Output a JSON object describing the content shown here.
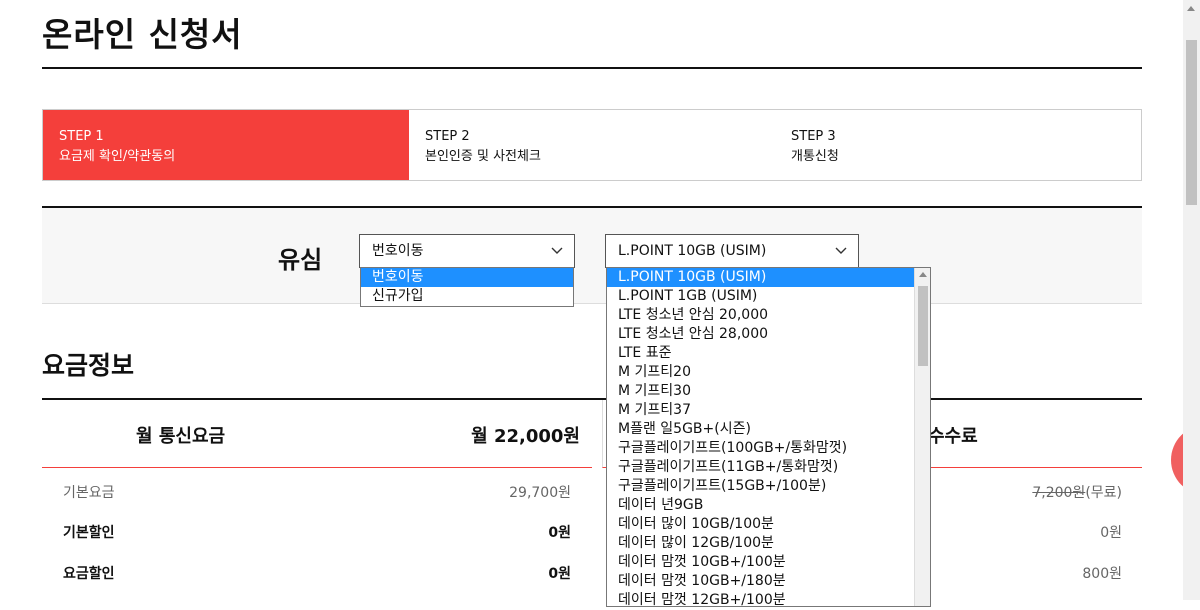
{
  "page_title": "온라인 신청서",
  "steps": [
    {
      "num": "STEP 1",
      "name": "요금제 확인/약관동의",
      "active": true
    },
    {
      "num": "STEP 2",
      "name": "본인인증 및 사전체크",
      "active": false
    },
    {
      "num": "STEP 3",
      "name": "개통신청",
      "active": false
    }
  ],
  "usim": {
    "label": "유심",
    "join_type_value": "번호이동",
    "join_type_options": [
      "번호이동",
      "신규가입"
    ],
    "plan_value": "L.POINT 10GB (USIM)",
    "plan_options": [
      "L.POINT 10GB (USIM)",
      "L.POINT 1GB (USIM)",
      "LTE 청소년 안심 20,000",
      "LTE 청소년 안심 28,000",
      "LTE 표준",
      "M 기프티20",
      "M 기프티30",
      "M 기프티37",
      "M플랜 일5GB+(시즌)",
      "구글플레이기프트(100GB+/통화맘껏)",
      "구글플레이기프트(11GB+/통화맘껏)",
      "구글플레이기프트(15GB+/100분)",
      "데이터 년9GB",
      "데이터 많이 10GB/100분",
      "데이터 많이 12GB/100분",
      "데이터 맘껏 10GB+/100분",
      "데이터 맘껏 10GB+/180분",
      "데이터 맘껏 12GB+/100분"
    ]
  },
  "fee": {
    "title": "요금정보",
    "monthly_label": "월 통신요금",
    "monthly_amount": "월 22,000원",
    "right_label": "수수료",
    "rows": [
      {
        "label": "기본요금",
        "value": "29,700원"
      },
      {
        "label": "기본할인",
        "value": "0원"
      },
      {
        "label": "요금할인",
        "value": "0원"
      }
    ],
    "right_rows": [
      {
        "strike": "7,200원",
        "suffix": "(무료)"
      },
      {
        "value": "0원"
      },
      {
        "value": "800원"
      }
    ]
  },
  "colors": {
    "accent": "#f43f3b",
    "selected": "#1e90ff"
  }
}
